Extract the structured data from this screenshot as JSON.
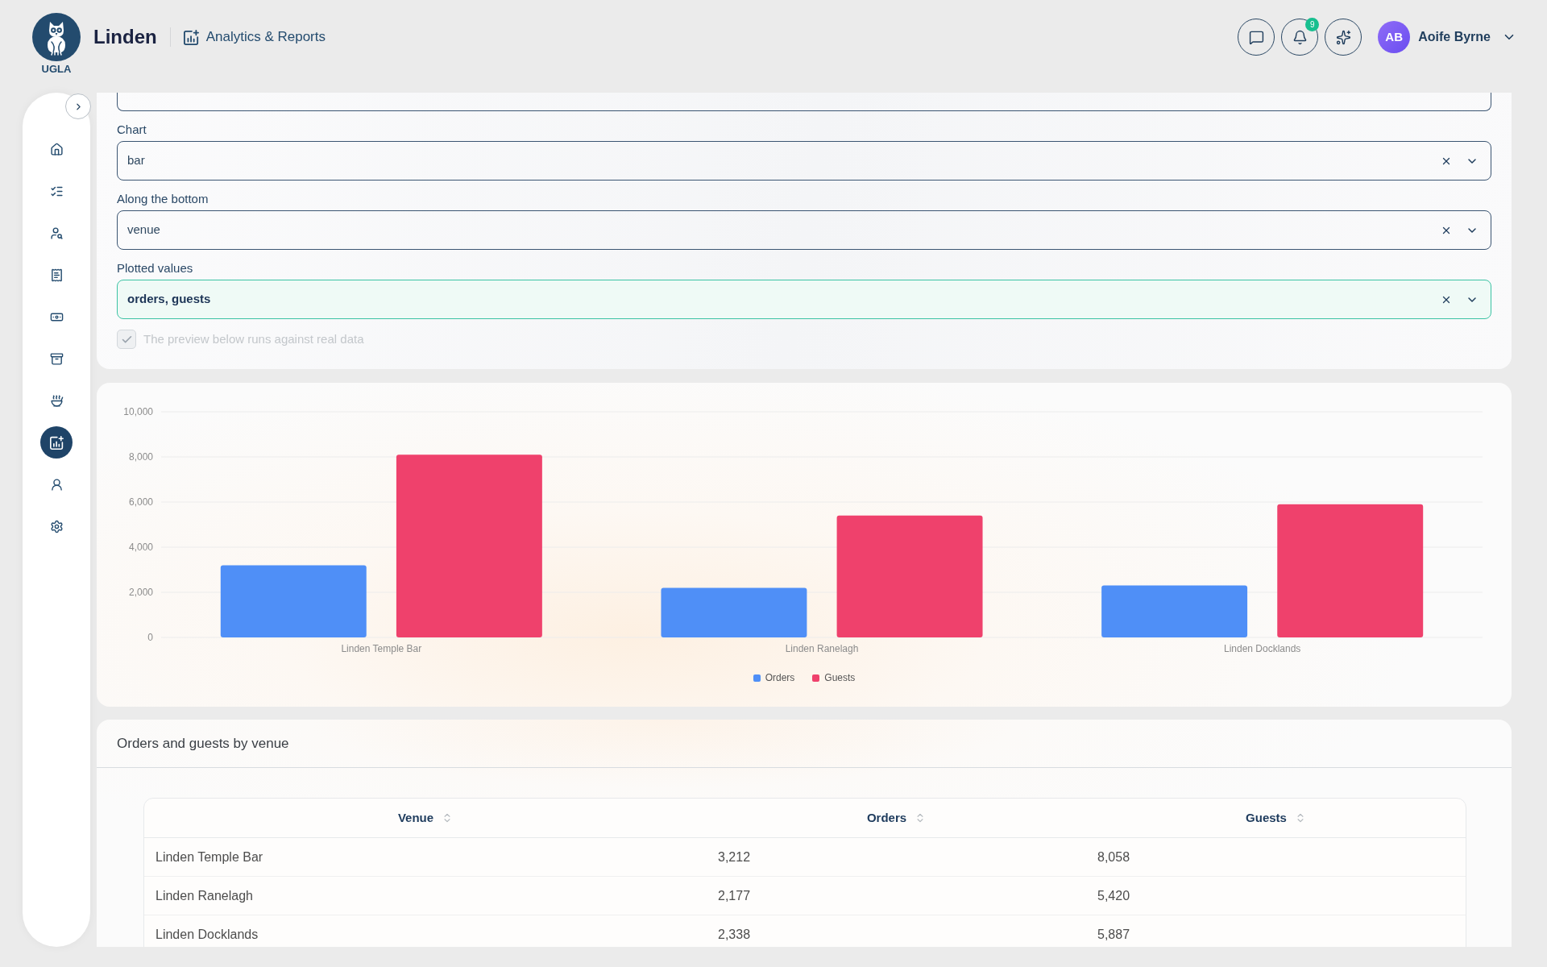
{
  "brand": {
    "logo_text": "UGLA",
    "name": "Linden",
    "section": "Analytics & Reports"
  },
  "header": {
    "actions": [
      {
        "kind": "messages"
      },
      {
        "kind": "notifications",
        "badge": "9"
      },
      {
        "kind": "assistant"
      }
    ],
    "user": {
      "initials": "AB",
      "name": "Aoife Byrne"
    }
  },
  "sidebar": {
    "items": [
      {
        "kind": "home",
        "selected": false
      },
      {
        "kind": "tasks",
        "selected": false
      },
      {
        "kind": "customers",
        "selected": false
      },
      {
        "kind": "receipts",
        "selected": false
      },
      {
        "kind": "payments",
        "selected": false
      },
      {
        "kind": "archive",
        "selected": false
      },
      {
        "kind": "kitchen",
        "selected": false
      },
      {
        "kind": "reports",
        "selected": true
      },
      {
        "kind": "staff",
        "selected": false
      },
      {
        "kind": "settings",
        "selected": false
      }
    ]
  },
  "form": {
    "fields": [
      {
        "label": "Chart",
        "value": "bar",
        "focused": false
      },
      {
        "label": "Along the bottom",
        "value": "venue",
        "focused": false
      },
      {
        "label": "Plotted values",
        "value": "orders, guests",
        "focused": true
      }
    ],
    "preview_check": {
      "label": "The preview below runs against real data",
      "checked": true,
      "disabled": true
    }
  },
  "chart": {
    "chart_data": {
      "type": "bar",
      "categories": [
        "Linden Temple Bar",
        "Linden Ranelagh",
        "Linden Docklands"
      ],
      "series": [
        {
          "name": "Orders",
          "color": "#4f8ff7",
          "values": [
            3200,
            2200,
            2300
          ]
        },
        {
          "name": "Guests",
          "color": "#ef416c",
          "values": [
            8100,
            5400,
            5900
          ]
        }
      ],
      "ylim": [
        0,
        10000
      ],
      "yticks": [
        {
          "value": 0,
          "label": "0"
        },
        {
          "value": 2000,
          "label": "2,000"
        },
        {
          "value": 4000,
          "label": "4,000"
        },
        {
          "value": 6000,
          "label": "6,000"
        },
        {
          "value": 8000,
          "label": "8,000"
        },
        {
          "value": 10000,
          "label": "10,000"
        }
      ],
      "grid": true,
      "legend": true
    }
  },
  "table": {
    "title": "Orders and guests by venue",
    "columns": [
      {
        "label": "Venue"
      },
      {
        "label": "Orders"
      },
      {
        "label": "Guests"
      }
    ],
    "rows": [
      [
        "Linden Temple Bar",
        "3,212",
        "8,058"
      ],
      [
        "Linden Ranelagh",
        "2,177",
        "5,420"
      ],
      [
        "Linden Docklands",
        "2,338",
        "5,887"
      ]
    ]
  }
}
